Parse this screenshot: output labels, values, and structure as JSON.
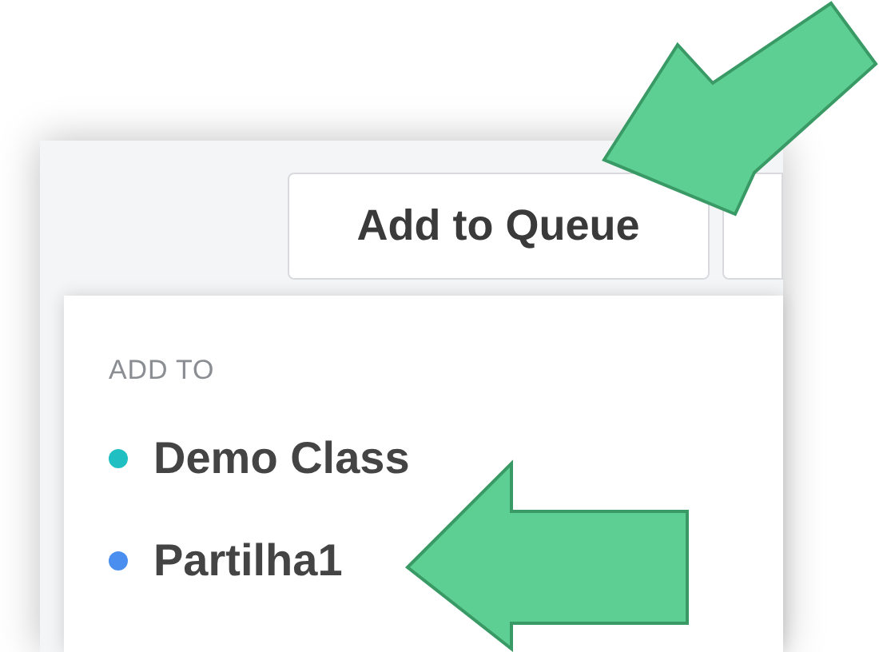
{
  "toolbar": {
    "buttons": [
      {
        "label": "Add to Queue"
      }
    ]
  },
  "dropdown": {
    "heading": "ADD TO",
    "items": [
      {
        "label": "Demo Class",
        "color": "#1fbfc2"
      },
      {
        "label": "Partilha1",
        "color": "#4a8ff0"
      }
    ]
  }
}
